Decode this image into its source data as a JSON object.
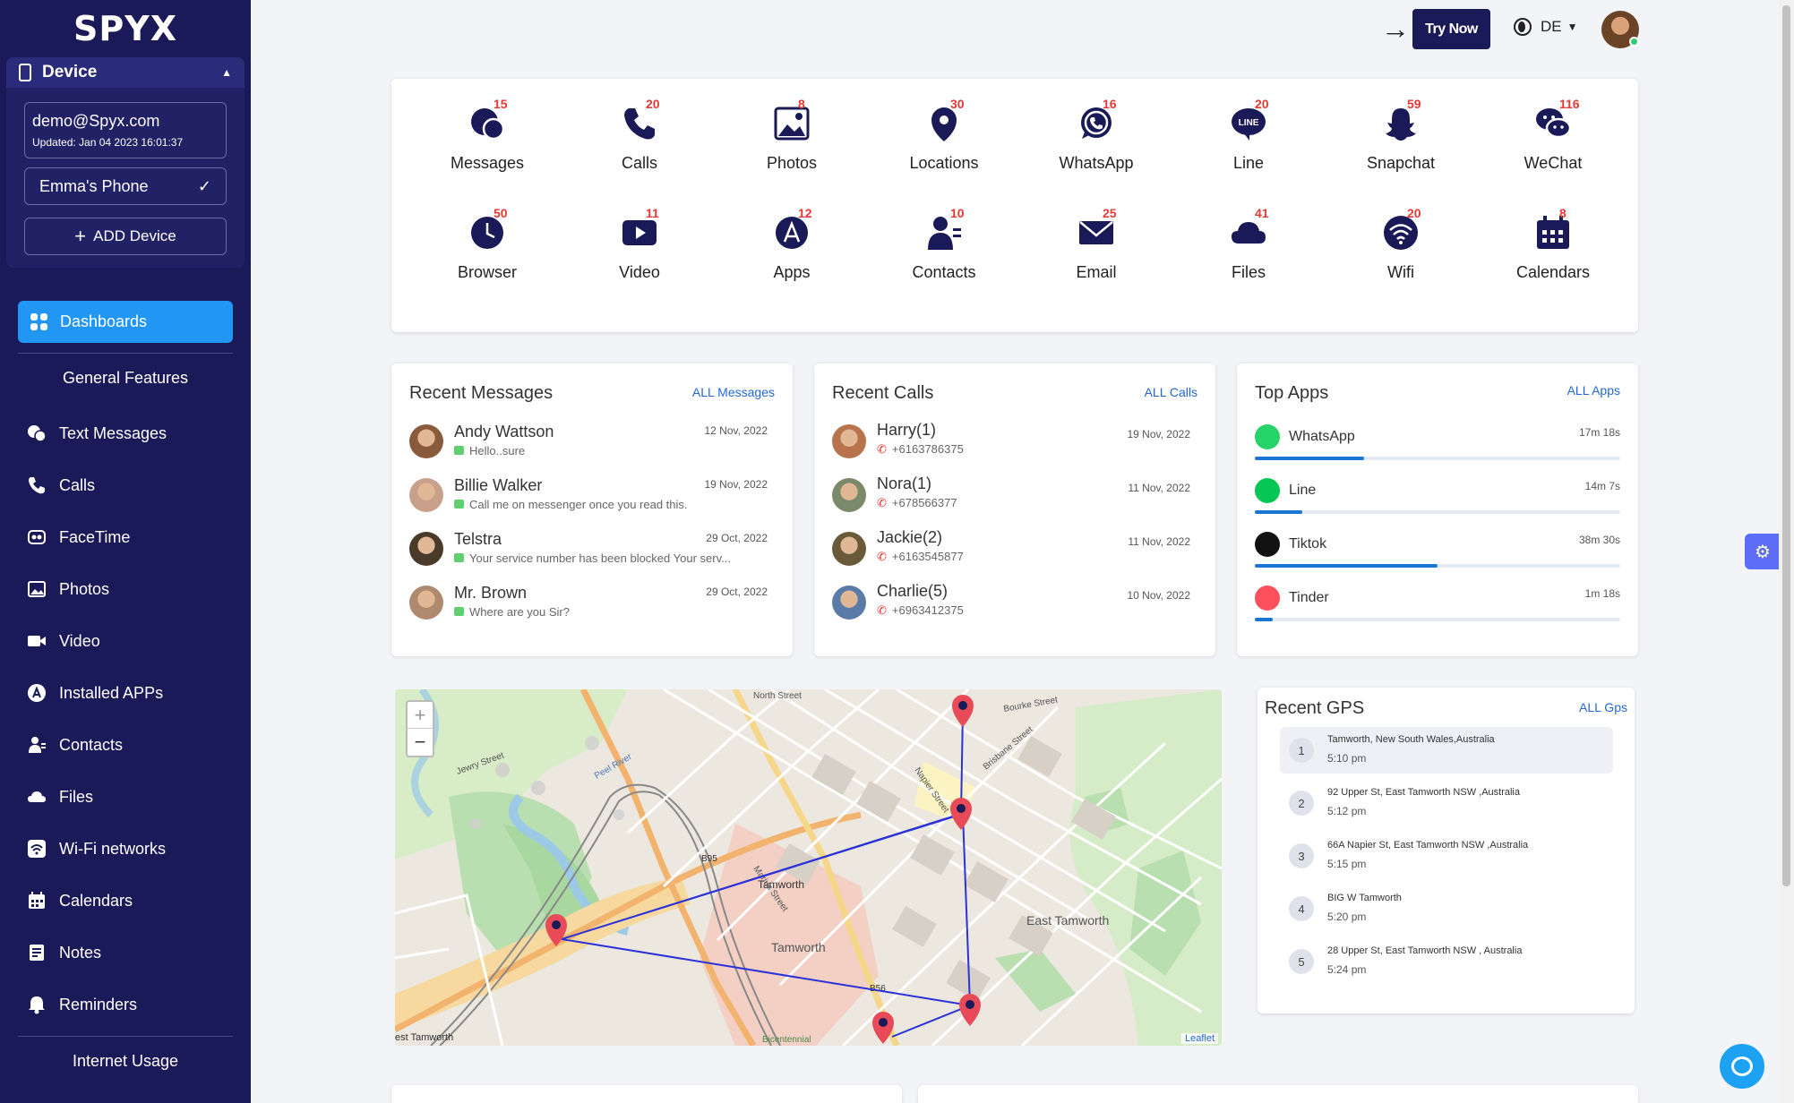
{
  "logo": "SPYX",
  "device": {
    "title": "Device",
    "email": "demo@Spyx.com",
    "updated": "Updated: Jan 04 2023 16:01:37",
    "phone": "Emma's Phone",
    "add": "ADD Device"
  },
  "nav": {
    "dashboards": "Dashboards",
    "general": "General Features",
    "internet": "Internet Usage",
    "items": [
      "Text Messages",
      "Calls",
      "FaceTime",
      "Photos",
      "Video",
      "Installed APPs",
      "Contacts",
      "Files",
      "Wi-Fi networks",
      "Calendars",
      "Notes",
      "Reminders"
    ]
  },
  "header": {
    "try": "Try Now",
    "lang": "DE"
  },
  "features": [
    {
      "label": "Messages",
      "count": "15",
      "icon": "messages-icon"
    },
    {
      "label": "Calls",
      "count": "20",
      "icon": "phone-icon"
    },
    {
      "label": "Photos",
      "count": "8",
      "icon": "photos-icon"
    },
    {
      "label": "Locations",
      "count": "30",
      "icon": "location-icon"
    },
    {
      "label": "WhatsApp",
      "count": "16",
      "icon": "whatsapp-icon"
    },
    {
      "label": "Line",
      "count": "20",
      "icon": "line-icon"
    },
    {
      "label": "Snapchat",
      "count": "59",
      "icon": "snapchat-icon"
    },
    {
      "label": "WeChat",
      "count": "116",
      "icon": "wechat-icon"
    },
    {
      "label": "Browser",
      "count": "50",
      "icon": "clock-icon"
    },
    {
      "label": "Video",
      "count": "11",
      "icon": "video-icon"
    },
    {
      "label": "Apps",
      "count": "12",
      "icon": "appstore-icon"
    },
    {
      "label": "Contacts",
      "count": "10",
      "icon": "contacts-icon"
    },
    {
      "label": "Email",
      "count": "25",
      "icon": "email-icon"
    },
    {
      "label": "Files",
      "count": "41",
      "icon": "cloud-icon"
    },
    {
      "label": "Wifi",
      "count": "20",
      "icon": "wifi-icon"
    },
    {
      "label": "Calendars",
      "count": "8",
      "icon": "calendar-icon"
    }
  ],
  "messages": {
    "title": "Recent Messages",
    "all": "ALL Messages",
    "rows": [
      {
        "name": "Andy Wattson",
        "text": "Hello..sure",
        "date": "12 Nov, 2022"
      },
      {
        "name": "Billie Walker",
        "text": "Call me on messenger once you read this.",
        "date": "19 Nov, 2022"
      },
      {
        "name": "Telstra",
        "text": "Your service number has been blocked Your serv...",
        "date": "29 Oct, 2022"
      },
      {
        "name": "Mr. Brown",
        "text": "Where are you Sir?",
        "date": "29 Oct, 2022"
      }
    ]
  },
  "calls": {
    "title": "Recent Calls",
    "all": "ALL Calls",
    "rows": [
      {
        "name": "Harry(1)",
        "num": "+6163786375",
        "date": "19 Nov, 2022"
      },
      {
        "name": "Nora(1)",
        "num": "+678566377",
        "date": "11 Nov, 2022"
      },
      {
        "name": "Jackie(2)",
        "num": "+6163545877",
        "date": "11 Nov, 2022"
      },
      {
        "name": "Charlie(5)",
        "num": "+6963412375",
        "date": "10 Nov, 2022"
      }
    ]
  },
  "apps": {
    "title": "Top Apps",
    "all": "ALL Apps",
    "rows": [
      {
        "name": "WhatsApp",
        "time": "17m 18s",
        "pct": 30,
        "color": "#25d366"
      },
      {
        "name": "Line",
        "time": "14m 7s",
        "pct": 13,
        "color": "#06c755"
      },
      {
        "name": "Tiktok",
        "time": "38m 30s",
        "pct": 50,
        "color": "#111111"
      },
      {
        "name": "Tinder",
        "time": "1m 18s",
        "pct": 5,
        "color": "#fe4f5c"
      }
    ]
  },
  "map": {
    "labels": [
      "Jewry Street",
      "Tamworth",
      "East Tamworth",
      "Bicentennial",
      "Peel River",
      "Marius Street",
      "North Street",
      "Bourke Street",
      "Brisbane Street",
      "Napier Street",
      "B56",
      "B95",
      "est Tamworth"
    ],
    "attribution": "Leaflet"
  },
  "gps": {
    "title": "Recent GPS",
    "all": "ALL Gps",
    "rows": [
      {
        "n": "1",
        "addr": "Tamworth, New South Wales,Australia",
        "time": "5:10 pm"
      },
      {
        "n": "2",
        "addr": "92 Upper St,  East Tamworth NSW ,Australia",
        "time": "5:12 pm"
      },
      {
        "n": "3",
        "addr": "66A Napier St,  East Tamworth NSW ,Australia",
        "time": "5:15 pm"
      },
      {
        "n": "4",
        "addr": "BIG W Tamworth",
        "time": "5:20 pm"
      },
      {
        "n": "5",
        "addr": "28 Upper St,  East Tamworth NSW , Australia",
        "time": "5:24 pm"
      }
    ]
  }
}
